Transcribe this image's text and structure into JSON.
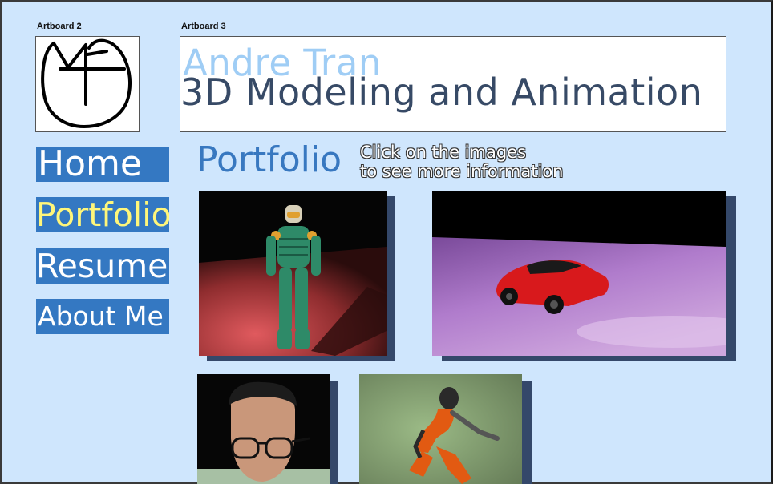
{
  "artboards": {
    "left_label": "Artboard 2",
    "right_label": "Artboard 3"
  },
  "header": {
    "name": "Andre Tran",
    "subtitle": "3D Modeling and Animation"
  },
  "nav": {
    "items": [
      {
        "label": "Home",
        "active": false
      },
      {
        "label": "Portfolio",
        "active": true
      },
      {
        "label": "Resume",
        "active": false
      },
      {
        "label": "About Me",
        "active": false
      }
    ]
  },
  "main": {
    "section_title": "Portfolio",
    "hint_line1": "Click on the images",
    "hint_line2": "to see more information"
  },
  "colors": {
    "page_bg": "#cfe6fd",
    "nav_bg": "#3478c2",
    "nav_text": "#ffffff",
    "nav_active_text": "#fff67a",
    "name_color": "#9fcdf5",
    "subtitle_color": "#374a66",
    "section_title_color": "#3878c0",
    "thumb_shadow": "#34486a"
  },
  "icons": {
    "logo": "at-monogram-logo"
  }
}
